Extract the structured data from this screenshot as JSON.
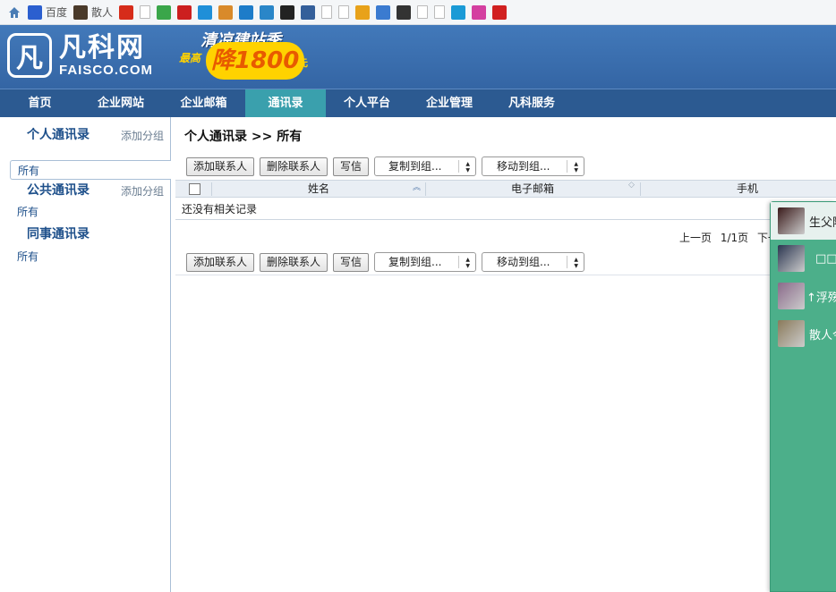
{
  "bookmarks": [
    {
      "icon": "home-icon",
      "label": "",
      "color": "#4a7db5"
    },
    {
      "icon": "baidu-paw-icon",
      "label": "百度",
      "color": "#2b5fcf"
    },
    {
      "icon": "sanren-icon",
      "label": "散人",
      "color": "#4a3a2a"
    },
    {
      "icon": "ithome-icon",
      "label": "",
      "color": "#d62c1a"
    },
    {
      "icon": "page-icon",
      "label": "",
      "color": "#ffffff"
    },
    {
      "icon": "green-box-icon",
      "label": "",
      "color": "#3aa64a"
    },
    {
      "icon": "red-grid-icon",
      "label": "",
      "color": "#cc1f1f"
    },
    {
      "icon": "blue-swirl-icon",
      "label": "",
      "color": "#1f8fd8"
    },
    {
      "icon": "monkey-icon",
      "label": "",
      "color": "#d98a2a"
    },
    {
      "icon": "t-logo-icon",
      "label": "",
      "color": "#1d7cc9"
    },
    {
      "icon": "eye-icon",
      "label": "",
      "color": "#2a86c8"
    },
    {
      "icon": "sina-icon",
      "label": "",
      "color": "#222222"
    },
    {
      "icon": "monitor-icon",
      "label": "",
      "color": "#345f9a"
    },
    {
      "icon": "page-icon",
      "label": "",
      "color": "#ffffff"
    },
    {
      "icon": "page-icon",
      "label": "",
      "color": "#ffffff"
    },
    {
      "icon": "chrome-icon",
      "label": "",
      "color": "#e8a21a"
    },
    {
      "icon": "picture-icon",
      "label": "",
      "color": "#3b7bd0"
    },
    {
      "icon": "dark-circle-icon",
      "label": "",
      "color": "#333333"
    },
    {
      "icon": "page-icon",
      "label": "",
      "color": "#ffffff"
    },
    {
      "icon": "page-icon",
      "label": "",
      "color": "#ffffff"
    },
    {
      "icon": "china-mobile-icon",
      "label": "",
      "color": "#1a9ad6"
    },
    {
      "icon": "em-icon",
      "label": "",
      "color": "#d43fa0"
    },
    {
      "icon": "red-square-icon",
      "label": "",
      "color": "#d12020"
    }
  ],
  "header": {
    "logo_mark": "凡",
    "logo_cn": "凡科网",
    "logo_en": "FAISCO.COM",
    "promo_top": "清凉建站季",
    "promo_left": "最高",
    "promo_main": "降1800",
    "promo_unit": "元"
  },
  "nav": [
    {
      "label": "首页",
      "active": false
    },
    {
      "label": "企业网站",
      "active": false
    },
    {
      "label": "企业邮箱",
      "active": false
    },
    {
      "label": "通讯录",
      "active": true
    },
    {
      "label": "个人平台",
      "active": false
    },
    {
      "label": "企业管理",
      "active": false
    },
    {
      "label": "凡科服务",
      "active": false
    }
  ],
  "sidebar": {
    "groups": [
      {
        "title": "个人通讯录",
        "add_label": "添加分组",
        "items": [
          "所有"
        ]
      },
      {
        "title": "公共通讯录",
        "add_label": "添加分组",
        "items": [
          "所有"
        ]
      },
      {
        "title": "同事通讯录",
        "add_label": "",
        "items": [
          "所有"
        ]
      }
    ]
  },
  "main": {
    "title": "个人通讯录 >> 所有",
    "toolbar": {
      "add_contact": "添加联系人",
      "delete_contact": "删除联系人",
      "write_mail": "写信",
      "copy_to_group": "复制到组...",
      "move_to_group": "移动到组..."
    },
    "columns": [
      "姓名",
      "电子邮箱",
      "手机"
    ],
    "empty_text": "还没有相关记录",
    "pager": {
      "prev": "上一页",
      "page_info": "1/1页",
      "next": "下一页"
    }
  },
  "chat": {
    "contacts": [
      {
        "name": "生父除",
        "avatar_color": "#3a1a1a"
      },
      {
        "name": "□□",
        "avatar_color": "#2a3550"
      },
      {
        "name": "↑浮殇",
        "avatar_color": "#8a6a8a"
      },
      {
        "name": "散人今",
        "avatar_color": "#8a7a5a"
      }
    ]
  },
  "colors": {
    "header_bg": "#3c6fae",
    "nav_bg": "#2c5a91",
    "nav_active": "#3aa0ad",
    "chat_bg": "#4caf8a",
    "link_blue": "#1d4f8a"
  }
}
